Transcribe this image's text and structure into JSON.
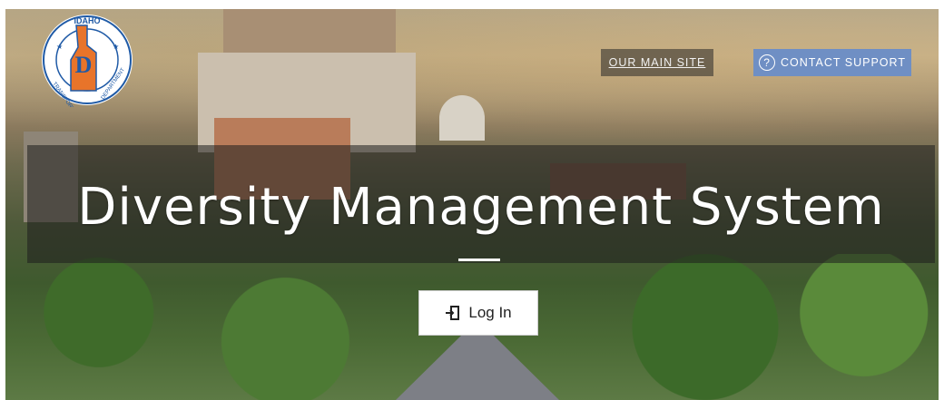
{
  "nav": {
    "main_site_label": "OUR MAIN SITE",
    "support_label": "CONTACT SUPPORT",
    "support_icon": "question-circle-icon"
  },
  "hero": {
    "title": "Diversity Management System",
    "login_label": "Log In",
    "login_icon": "sign-in-icon"
  },
  "logo": {
    "top_text": "IDAHO",
    "left_text": "TRANSPORTATION",
    "right_text": "DEPARTMENT",
    "letter": "D"
  },
  "colors": {
    "support_bg": "#6f8fc4",
    "logo_orange": "#e8742a",
    "logo_blue": "#1f5aa6"
  }
}
